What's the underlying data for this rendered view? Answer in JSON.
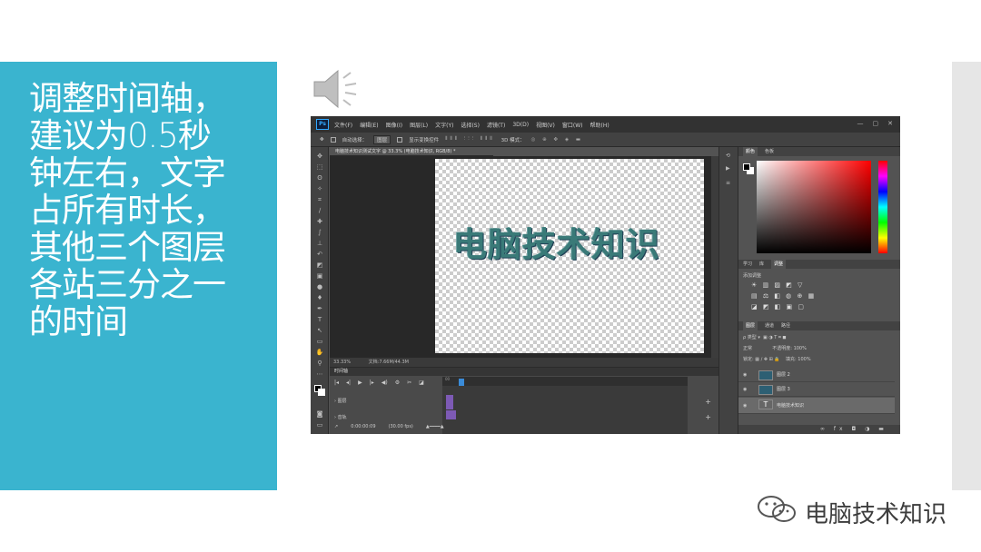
{
  "slide": {
    "text_lines": [
      "调整时间轴，",
      "建议为0.5秒",
      "钟左右，文字",
      "占所有时长，",
      "其他三个图层",
      "各站三分之一",
      "的时间"
    ],
    "colors": {
      "panel": "#3ab4cf",
      "text": "#ffffff",
      "right_bar": "#e6e6e6"
    },
    "icons": {
      "speaker": "speaker-icon"
    }
  },
  "photoshop": {
    "logo": "Ps",
    "menus": [
      "文件(F)",
      "编辑(E)",
      "图像(I)",
      "图层(L)",
      "文字(Y)",
      "选择(S)",
      "滤镜(T)",
      "3D(D)",
      "视图(V)",
      "窗口(W)",
      "帮助(H)"
    ],
    "window_controls": [
      "—",
      "▢",
      "✕"
    ],
    "options_bar": {
      "auto_select_label": "自动选择：",
      "auto_select_value": "图层",
      "show_transform_label": "显示变换控件",
      "mode_3d_label": "3D 模式："
    },
    "document_tab": "电脑技术知识测试文字 @ 33.3% (电脑技术知识, RGB/8) *",
    "canvas_text": "电脑技术知识",
    "status_bar": {
      "zoom": "33.33%",
      "doc": "文档:7.66M/44.3M"
    },
    "timeline": {
      "title": "时间轴",
      "layer_1": "图层",
      "layer_2": "音轨",
      "timecode": "0:00:00:09",
      "fps": "(30.00 fps)",
      "ruler_mark": "00"
    },
    "panels": {
      "color_tabs": [
        "颜色",
        "色板"
      ],
      "adjust_tabs": [
        "学习",
        "库",
        "调整"
      ],
      "adjust_label": "添加调整",
      "layers_tabs": [
        "图层",
        "通道",
        "路径"
      ],
      "filter_label": "ρ 类型",
      "blend_mode": "正常",
      "opacity_label": "不透明度:",
      "opacity_value": "100%",
      "lock_label": "锁定:",
      "fill_label": "填充:",
      "fill_value": "100%",
      "layers": [
        {
          "name": "图层 2",
          "type": "image"
        },
        {
          "name": "图层 3",
          "type": "image"
        },
        {
          "name": "电脑技术知识",
          "type": "text"
        }
      ]
    }
  },
  "watermark": {
    "text": "电脑技术知识",
    "icon": "wechat-icon"
  }
}
